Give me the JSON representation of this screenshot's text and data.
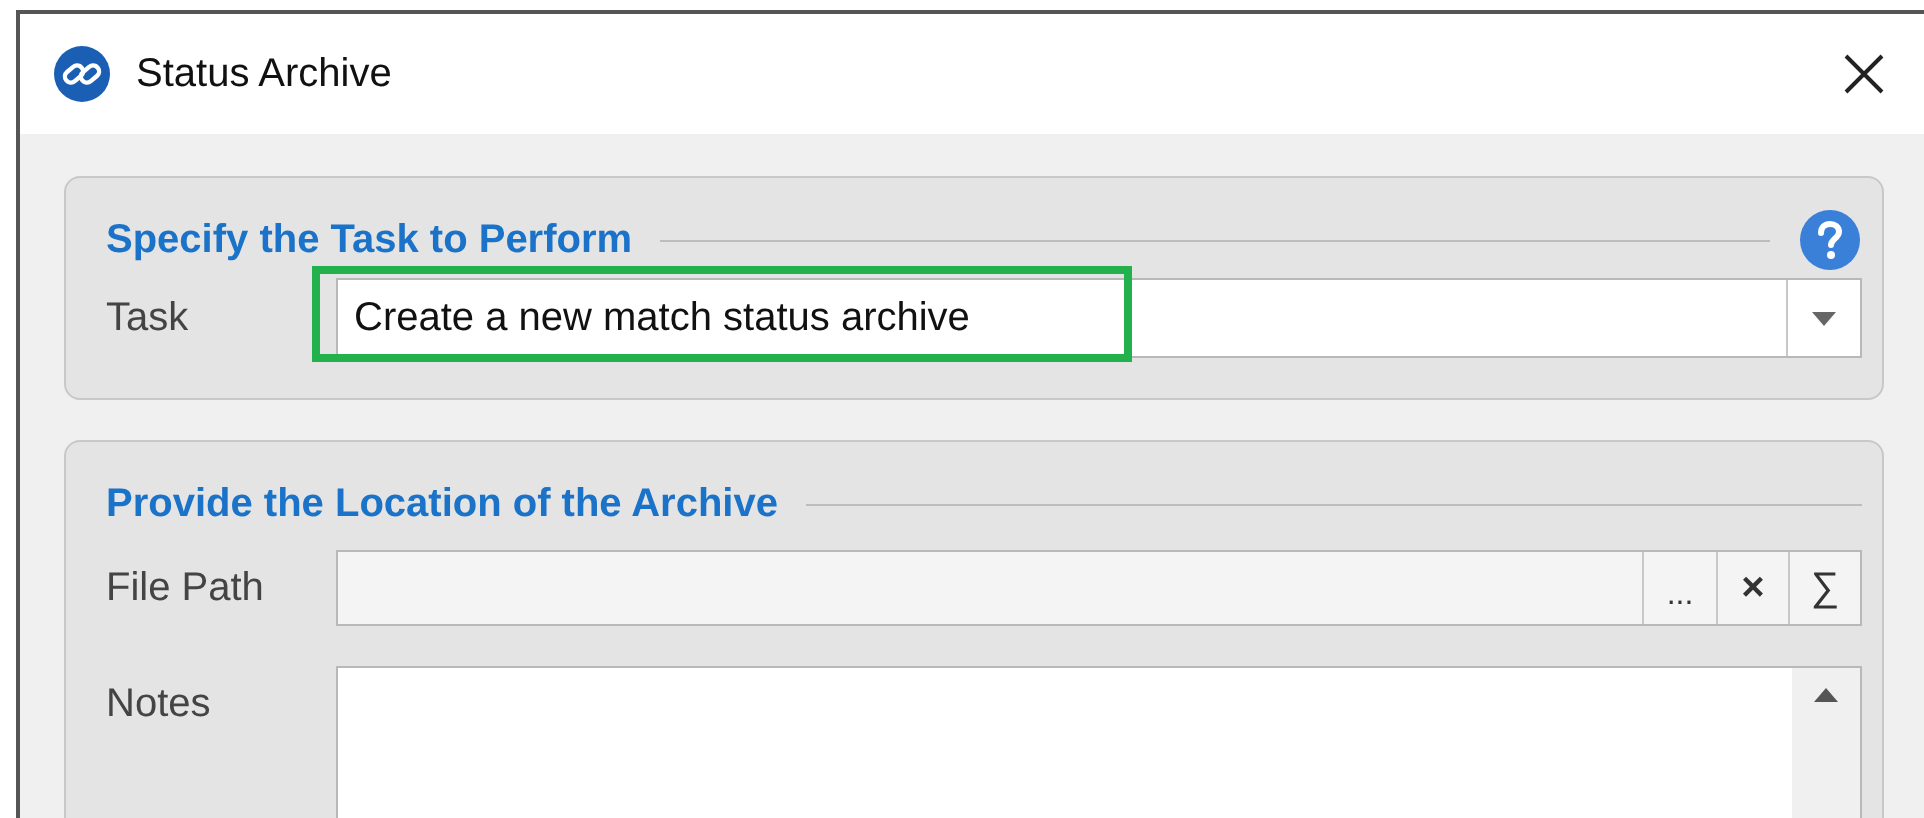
{
  "window": {
    "title": "Status Archive"
  },
  "task_section": {
    "heading": "Specify the Task to Perform",
    "task": {
      "label": "Task",
      "value": "Create a new match status archive",
      "highlighted": true
    }
  },
  "location_section": {
    "heading": "Provide the Location of the Archive",
    "file_path": {
      "label": "File Path",
      "buttons": [
        "...",
        "×",
        "∑"
      ]
    },
    "notes": {
      "label": "Notes"
    }
  }
}
